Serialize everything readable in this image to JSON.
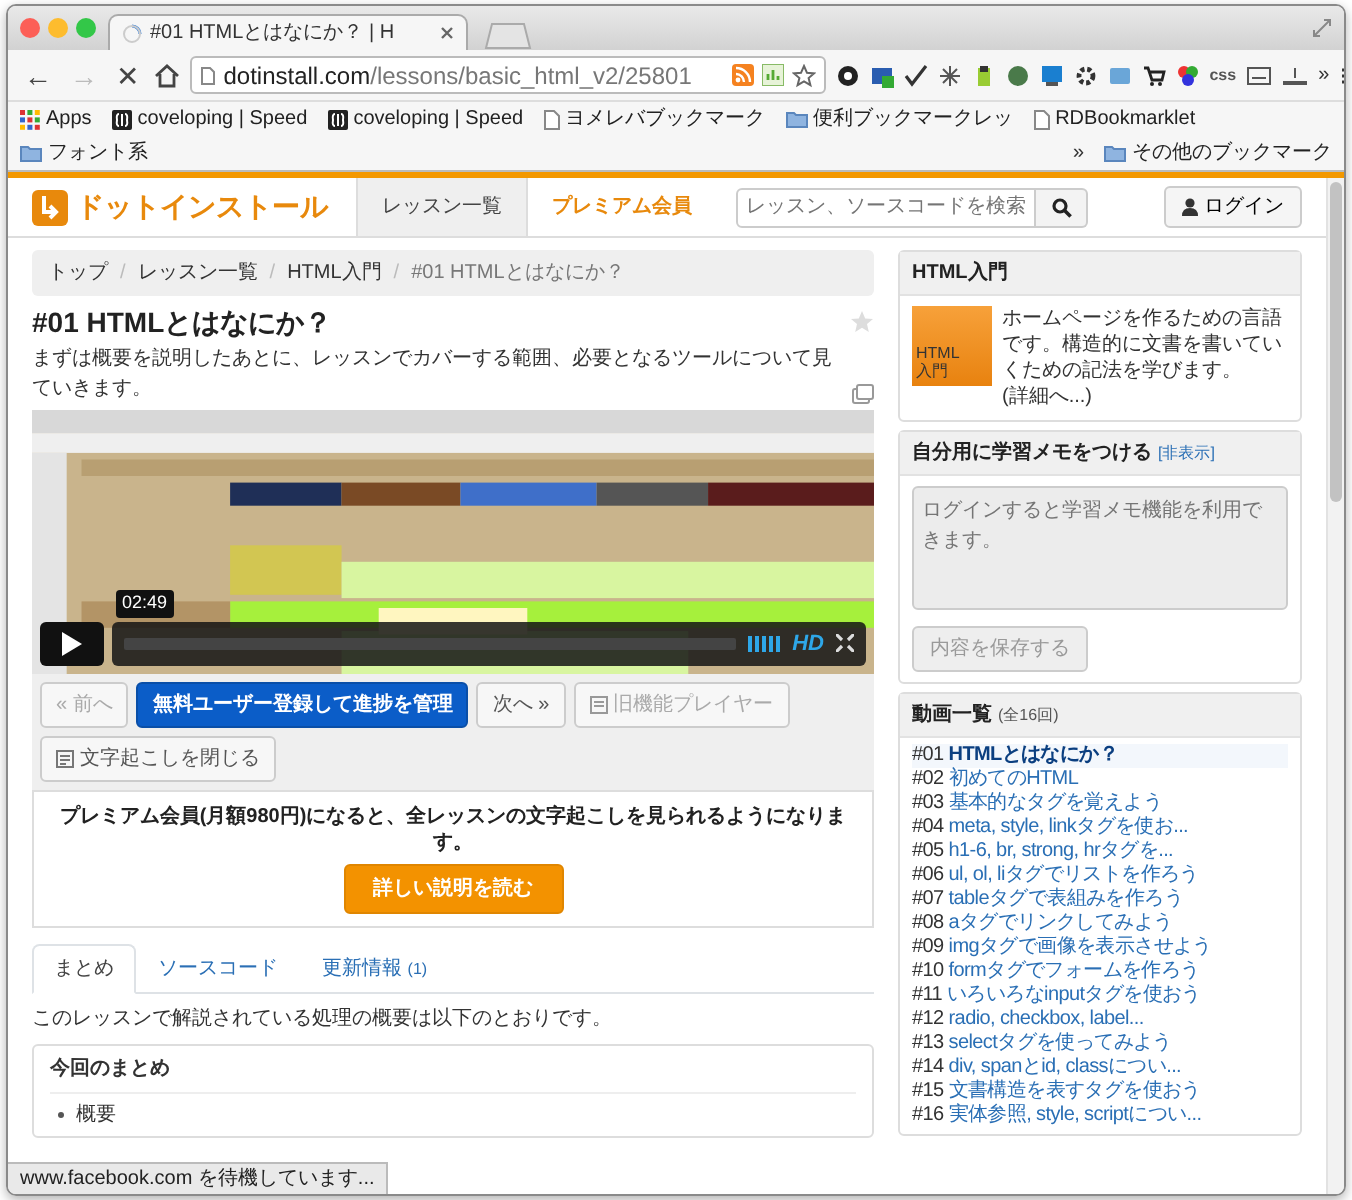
{
  "window": {
    "tab_title": "#01 HTMLとはなにか？ | H"
  },
  "toolbar": {
    "nav": [
      {
        "glyph": "←",
        "disabled": false
      },
      {
        "glyph": "→",
        "disabled": true
      },
      {
        "glyph": "✕",
        "disabled": false
      }
    ],
    "address_host": "dotinstall.com",
    "address_path": "/lessons/basic_html_v2/25801",
    "extension_label": "css",
    "overflow": "»"
  },
  "bookmarks": {
    "items": [
      {
        "kind": "apps",
        "label": "Apps"
      },
      {
        "kind": "site",
        "label": "coveloping | Speed"
      },
      {
        "kind": "site",
        "label": "coveloping | Speed"
      },
      {
        "kind": "page",
        "label": "ヨメレバブックマーク"
      },
      {
        "kind": "folder",
        "label": "便利ブックマークレッ"
      },
      {
        "kind": "page",
        "label": "RDBookmarklet"
      },
      {
        "kind": "folder",
        "label": "フォント系"
      }
    ],
    "overflow": "»",
    "other": "その他のブックマーク"
  },
  "header": {
    "logo": "ドットインストール",
    "nav": [
      {
        "label": "レッスン一覧",
        "kind": "plain",
        "selected": true
      },
      {
        "label": "プレミアム会員",
        "kind": "premium",
        "selected": false
      }
    ],
    "search_placeholder": "レッスン、ソースコードを検索",
    "login": "ログイン"
  },
  "breadcrumb": {
    "separator": "/",
    "items": [
      {
        "label": "トップ",
        "link": true
      },
      {
        "label": "レッスン一覧",
        "link": true
      },
      {
        "label": "HTML入門",
        "link": true
      },
      {
        "label": "#01 HTMLとはなにか？",
        "link": false
      }
    ]
  },
  "lesson": {
    "title": "#01 HTMLとはなにか？",
    "description": "まずは概要を説明したあとに、レッスンでカバーする範囲、必要となるツールについて見ていきます。",
    "video": {
      "time": "02:49",
      "quality": "HD"
    },
    "buttons": [
      {
        "label": "« 前へ",
        "kind": "plain",
        "disabled": true
      },
      {
        "label": "無料ユーザー登録して進捗を管理",
        "kind": "primary",
        "disabled": false
      },
      {
        "label": "次へ »",
        "kind": "plain",
        "disabled": false
      },
      {
        "label": "旧機能プレイヤー",
        "kind": "player",
        "disabled": true
      },
      {
        "label": "文字起こしを閉じる",
        "kind": "transcript",
        "disabled": false
      }
    ],
    "premium": {
      "message": "プレミアム会員(月額980円)になると、全レッスンの文字起こしを見られるようになります。",
      "button": "詳しい説明を読む"
    },
    "tabs": [
      {
        "label": "まとめ",
        "selected": true
      },
      {
        "label": "ソースコード",
        "selected": false
      },
      {
        "label": "更新情報",
        "count": "(1)",
        "selected": false
      }
    ],
    "summary": {
      "intro": "このレッスンで解説されている処理の概要は以下のとおりです。",
      "card_title": "今回のまとめ",
      "items": [
        "概要"
      ]
    }
  },
  "sidebar": {
    "course": {
      "title": "HTML入門",
      "thumb_lines": [
        "HTML",
        "入門"
      ],
      "description": "ホームページを作るための言語です。構造的に文書を書いていくための記法を学びます。",
      "more": "(詳細へ...)"
    },
    "memo": {
      "title": "自分用に学習メモをつける",
      "toggle": "[非表示]",
      "placeholder": "ログインすると学習メモ機能を利用できます。",
      "save": "内容を保存する",
      "disabled": true
    },
    "videos": {
      "title": "動画一覧",
      "count": "(全16回)",
      "items": [
        {
          "number": "#01",
          "title": "HTMLとはなにか？",
          "selected": true
        },
        {
          "number": "#02",
          "title": "初めてのHTML",
          "selected": false
        },
        {
          "number": "#03",
          "title": "基本的なタグを覚えよう",
          "selected": false
        },
        {
          "number": "#04",
          "title": "meta, style, linkタグを使お...",
          "selected": false
        },
        {
          "number": "#05",
          "title": "h1-6, br, strong, hrタグを...",
          "selected": false
        },
        {
          "number": "#06",
          "title": "ul, ol, liタグでリストを作ろう",
          "selected": false
        },
        {
          "number": "#07",
          "title": "tableタグで表組みを作ろう",
          "selected": false
        },
        {
          "number": "#08",
          "title": "aタグでリンクしてみよう",
          "selected": false
        },
        {
          "number": "#09",
          "title": "imgタグで画像を表示させよう",
          "selected": false
        },
        {
          "number": "#10",
          "title": "formタグでフォームを作ろう",
          "selected": false
        },
        {
          "number": "#11",
          "title": "いろいろなinputタグを使おう",
          "selected": false
        },
        {
          "number": "#12",
          "title": "radio, checkbox, label...",
          "selected": false
        },
        {
          "number": "#13",
          "title": "selectタグを使ってみよう",
          "selected": false
        },
        {
          "number": "#14",
          "title": "div, spanとid, classについ...",
          "selected": false
        },
        {
          "number": "#15",
          "title": "文書構造を表すタグを使おう",
          "selected": false
        },
        {
          "number": "#16",
          "title": "実体参照, style, scriptについ...",
          "selected": false
        }
      ]
    }
  },
  "status_bar": "www.facebook.com を待機しています..."
}
